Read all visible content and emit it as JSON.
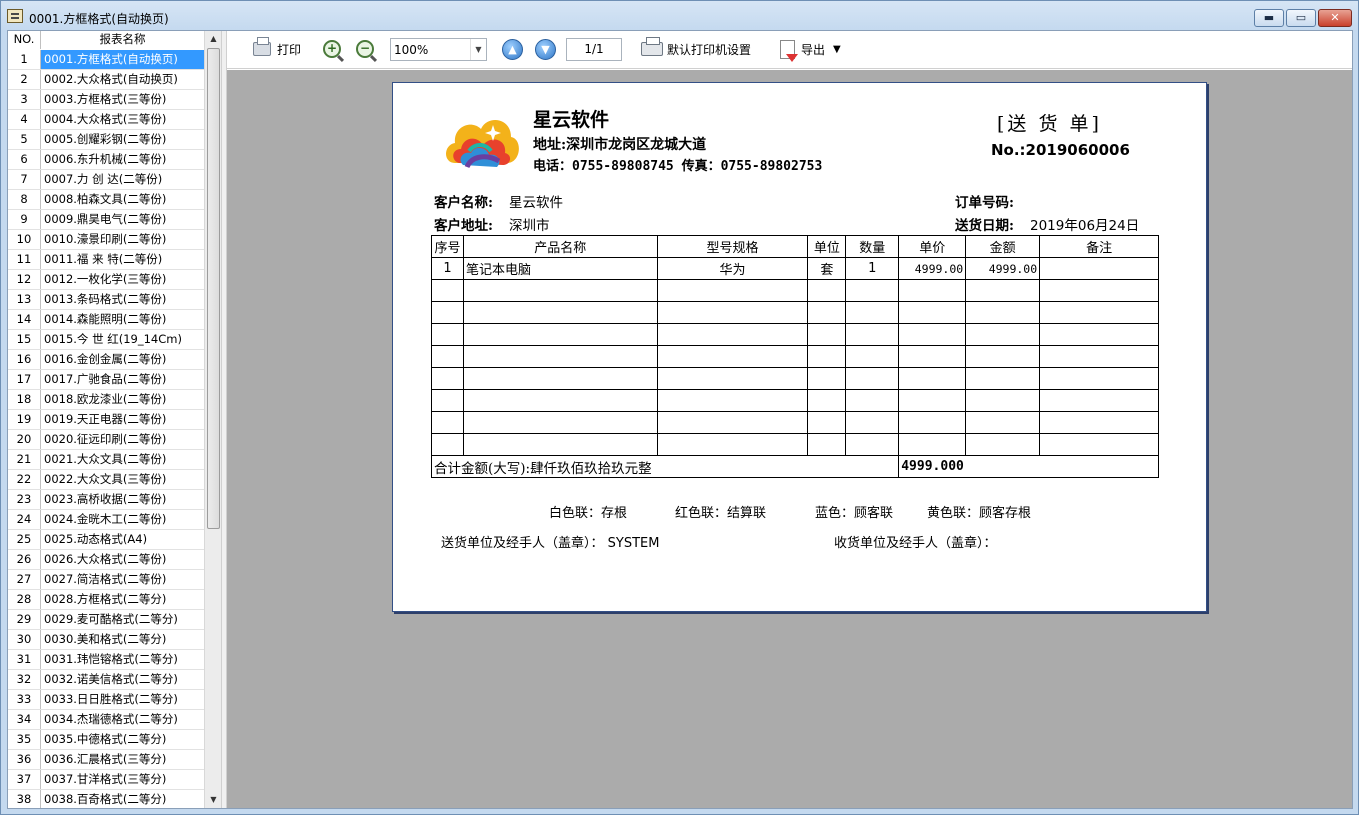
{
  "window": {
    "title": "0001.方框格式(自动换页)",
    "min_label": "▬",
    "max_label": "▭",
    "close_label": "✕"
  },
  "list": {
    "col_no": "NO.",
    "col_name": "报表名称",
    "selected_index": 0,
    "items": [
      {
        "no": "1",
        "name": "0001.方框格式(自动换页)"
      },
      {
        "no": "2",
        "name": "0002.大众格式(自动换页)"
      },
      {
        "no": "3",
        "name": "0003.方框格式(三等份)"
      },
      {
        "no": "4",
        "name": "0004.大众格式(三等份)"
      },
      {
        "no": "5",
        "name": "0005.创耀彩钢(二等份)"
      },
      {
        "no": "6",
        "name": "0006.东升机械(二等份)"
      },
      {
        "no": "7",
        "name": "0007.力 创 达(二等份)"
      },
      {
        "no": "8",
        "name": "0008.柏森文具(二等份)"
      },
      {
        "no": "9",
        "name": "0009.鼎昊电气(二等份)"
      },
      {
        "no": "10",
        "name": "0010.濠景印刷(二等份)"
      },
      {
        "no": "11",
        "name": "0011.福 来 特(二等份)"
      },
      {
        "no": "12",
        "name": "0012.一枚化学(三等份)"
      },
      {
        "no": "13",
        "name": "0013.条码格式(二等份)"
      },
      {
        "no": "14",
        "name": "0014.森能照明(二等份)"
      },
      {
        "no": "15",
        "name": "0015.今 世 红(19_14Cm)"
      },
      {
        "no": "16",
        "name": "0016.金创金属(二等份)"
      },
      {
        "no": "17",
        "name": "0017.广驰食品(二等份)"
      },
      {
        "no": "18",
        "name": "0018.欧龙漆业(二等份)"
      },
      {
        "no": "19",
        "name": "0019.天正电器(二等份)"
      },
      {
        "no": "20",
        "name": "0020.征远印刷(二等份)"
      },
      {
        "no": "21",
        "name": "0021.大众文具(二等份)"
      },
      {
        "no": "22",
        "name": "0022.大众文具(三等份)"
      },
      {
        "no": "23",
        "name": "0023.高桥收据(二等份)"
      },
      {
        "no": "24",
        "name": "0024.金晄木工(二等份)"
      },
      {
        "no": "25",
        "name": "0025.动态格式(A4)"
      },
      {
        "no": "26",
        "name": "0026.大众格式(二等份)"
      },
      {
        "no": "27",
        "name": "0027.简洁格式(二等份)"
      },
      {
        "no": "28",
        "name": "0028.方框格式(二等分)"
      },
      {
        "no": "29",
        "name": "0029.麦可酷格式(二等分)"
      },
      {
        "no": "30",
        "name": "0030.美和格式(二等分)"
      },
      {
        "no": "31",
        "name": "0031.玮恺镕格式(二等分)"
      },
      {
        "no": "32",
        "name": "0032.诺美信格式(二等分)"
      },
      {
        "no": "33",
        "name": "0033.日日胜格式(二等分)"
      },
      {
        "no": "34",
        "name": "0034.杰瑞德格式(二等分)"
      },
      {
        "no": "35",
        "name": "0035.中德格式(二等分)"
      },
      {
        "no": "36",
        "name": "0036.汇晨格式(三等分)"
      },
      {
        "no": "37",
        "name": "0037.甘洋格式(三等分)"
      },
      {
        "no": "38",
        "name": "0038.百奇格式(二等分)"
      }
    ]
  },
  "toolbar": {
    "print_label": "打印",
    "zoom_value": "100%",
    "page_value": "1/1",
    "printer_setup_label": "默认打印机设置",
    "export_label": "导出",
    "zoom_in_glyph": "+",
    "zoom_out_glyph": "−",
    "up_glyph": "▲",
    "down_glyph": "▼"
  },
  "doc": {
    "company": "星云软件",
    "address": "地址:深圳市龙岗区龙城大道",
    "phone": "电话：0755-89808745  传真：0755-89802753",
    "title": "[送 货 单]",
    "number": "No.:2019060006",
    "customer_label": "客户名称:",
    "customer": "星云软件",
    "cust_addr_label": "客户地址:",
    "cust_addr": "深圳市",
    "order_label": "订单号码:",
    "order": "",
    "date_label": "送货日期:",
    "date": "2019年06月24日",
    "columns": [
      "序号",
      "产品名称",
      "型号规格",
      "单位",
      "数量",
      "单价",
      "金额",
      "备注"
    ],
    "rows": [
      {
        "seq": "1",
        "name": "笔记本电脑",
        "spec": "华为",
        "unit": "套",
        "qty": "1",
        "price": "4999.00",
        "amount": "4999.00",
        "note": ""
      }
    ],
    "total_label": "合计金额(大写):肆仟玖佰玖拾玖元整",
    "total_value": "4999.000",
    "copies": [
      "白色联：存根",
      "红色联：结算联",
      "蓝色：顾客联",
      "黄色联：顾客存根"
    ],
    "sender": "送货单位及经手人（盖章）： SYSTEM",
    "receiver": "收货单位及经手人（盖章）："
  },
  "colors": {
    "selection": "#3399ff",
    "preview_bg": "#ababab"
  }
}
